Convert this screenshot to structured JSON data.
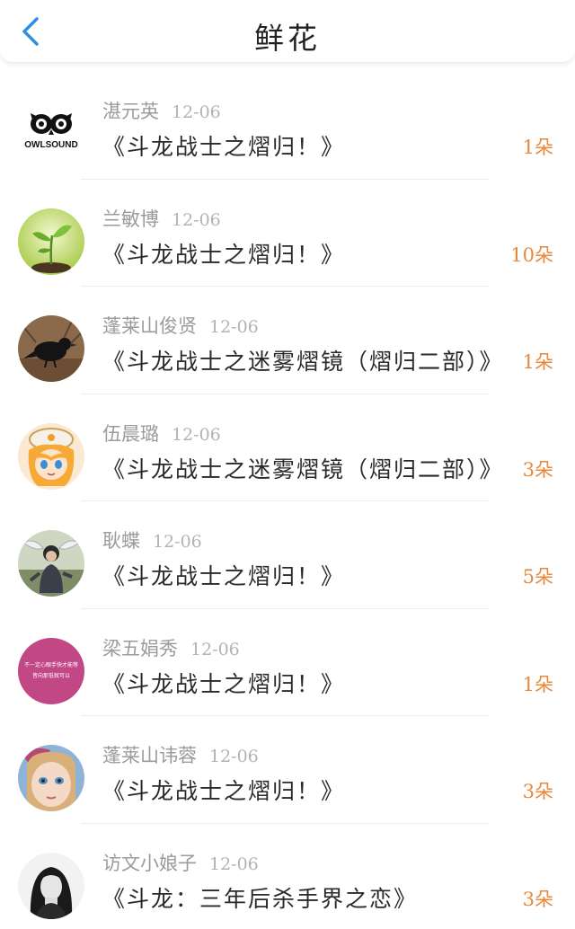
{
  "header": {
    "title": "鲜花",
    "back_icon": "chevron-left-icon",
    "accent_color": "#2f8fe6"
  },
  "count_color": "#e8883a",
  "items": [
    {
      "user": "湛元英",
      "date": "12-06",
      "book": "《斗龙战士之熠归！》",
      "count": "1朵",
      "avatar": "owl-logo"
    },
    {
      "user": "兰敏博",
      "date": "12-06",
      "book": "《斗龙战士之熠归！》",
      "count": "10朵",
      "avatar": "sprout-photo"
    },
    {
      "user": "蓬莱山俊贤",
      "date": "12-06",
      "book": "《斗龙战士之迷雾熠镜（熠归二部）》",
      "count": "1朵",
      "avatar": "crow-photo"
    },
    {
      "user": "伍晨璐",
      "date": "12-06",
      "book": "《斗龙战士之迷雾熠镜（熠归二部）》",
      "count": "3朵",
      "avatar": "anime-girl"
    },
    {
      "user": "耿蝶",
      "date": "12-06",
      "book": "《斗龙战士之熠归！》",
      "count": "5朵",
      "avatar": "person-with-wings"
    },
    {
      "user": "梁五娟秀",
      "date": "12-06",
      "book": "《斗龙战士之熠归！》",
      "count": "1朵",
      "avatar": "pink-text-card"
    },
    {
      "user": "蓬莱山讳蓉",
      "date": "12-06",
      "book": "《斗龙战士之熠归！》",
      "count": "3朵",
      "avatar": "doll-face"
    },
    {
      "user": "访文小娘子",
      "date": "12-06",
      "book": "《斗龙：三年后杀手界之恋》",
      "count": "3朵",
      "avatar": "bw-portrait"
    }
  ],
  "avatar_texts": {
    "owl": "OWLSOUND",
    "pink_line1": "不一定心眼手快才能等",
    "pink_line2": "皆向那低就可以"
  }
}
